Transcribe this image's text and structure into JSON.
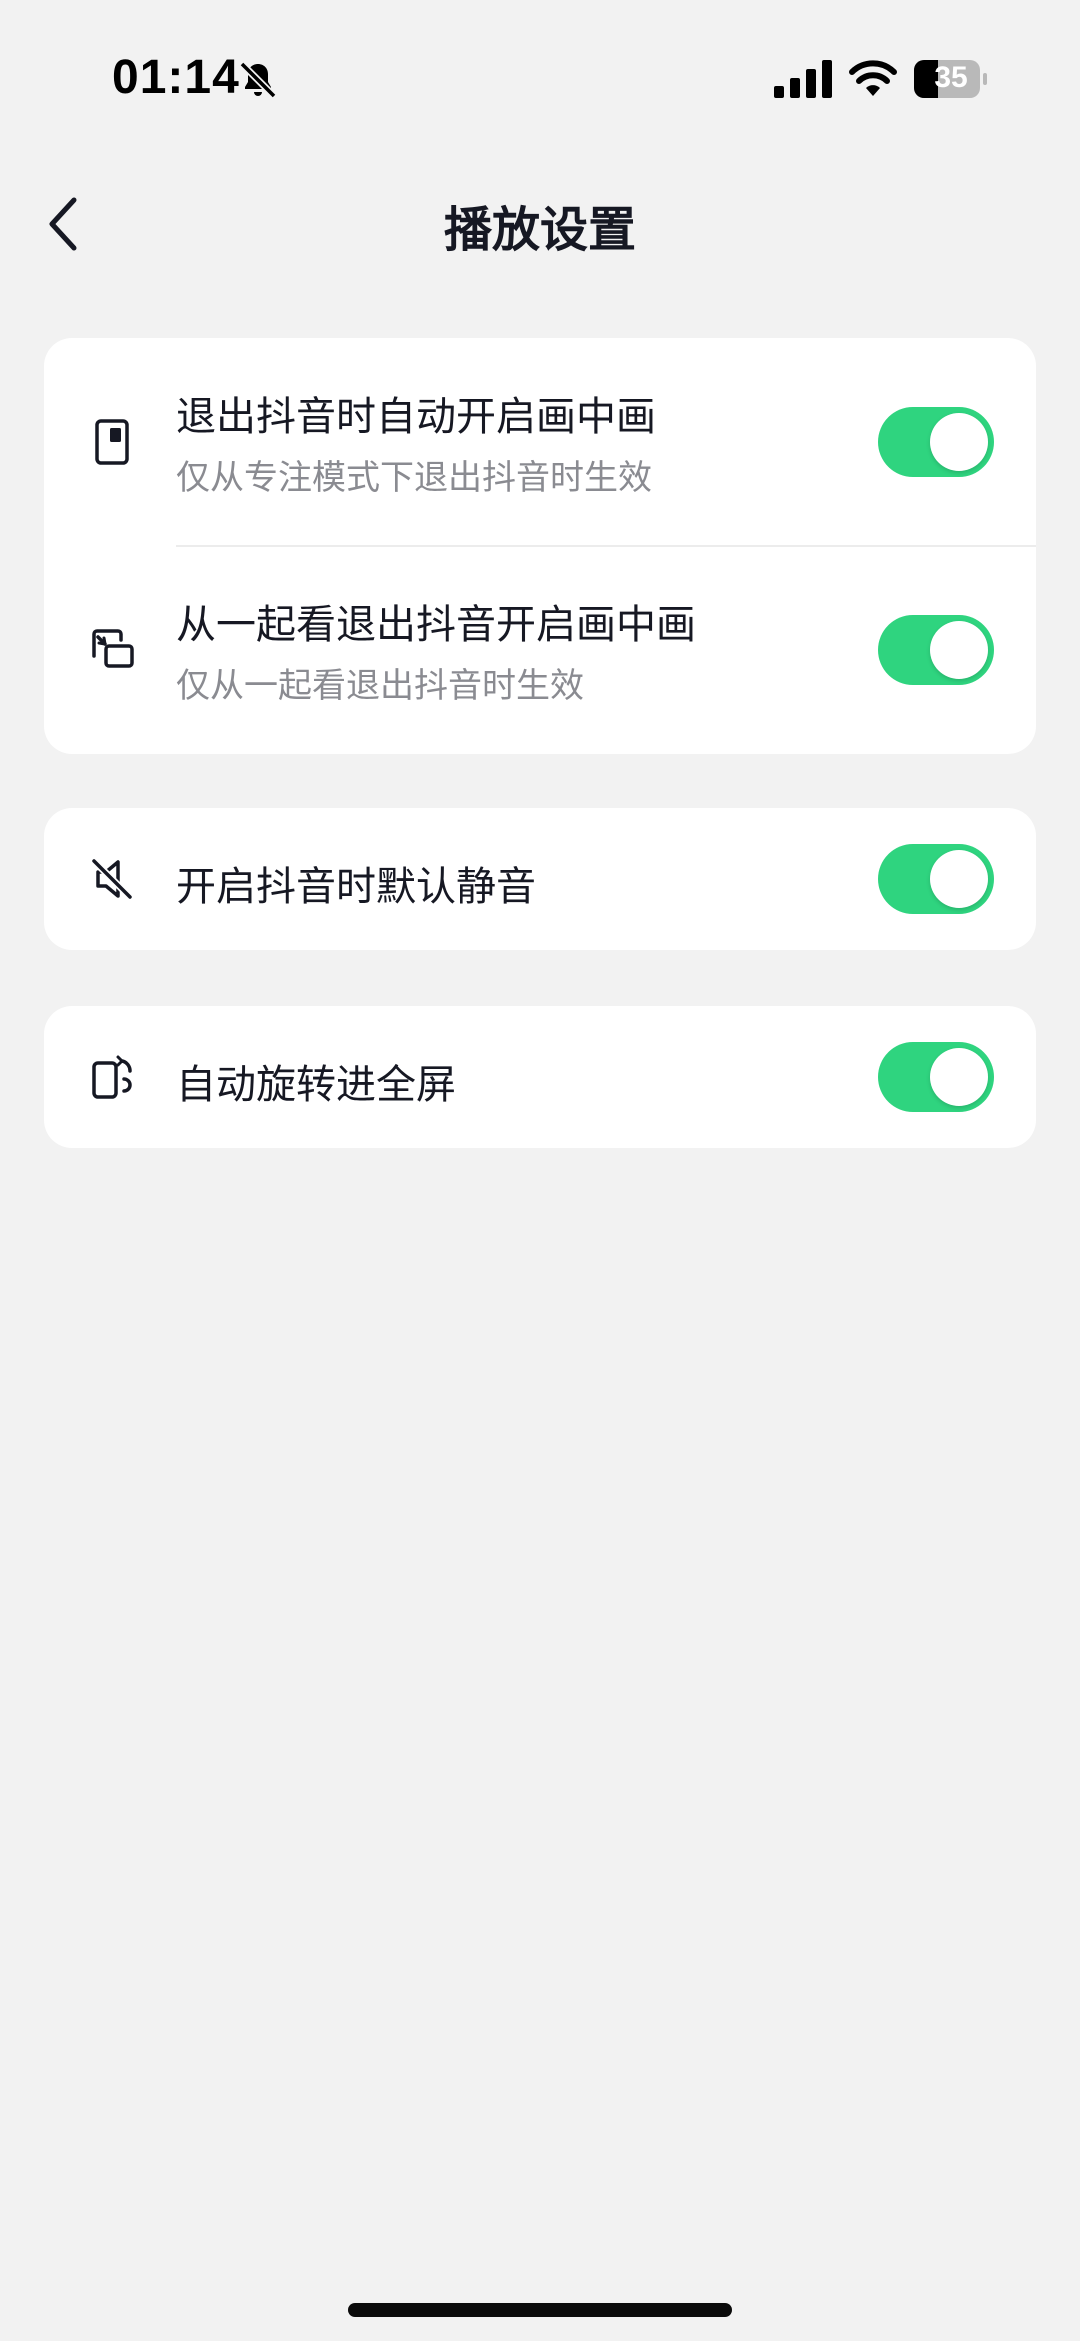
{
  "status_bar": {
    "time": "01:14",
    "battery": "35",
    "icons": [
      "bell-off-icon",
      "signal-icon",
      "wifi-icon",
      "battery-icon"
    ]
  },
  "header": {
    "title": "播放设置",
    "back_icon": "chevron-left-icon"
  },
  "settings": {
    "pip_auto": {
      "title": "退出抖音时自动开启画中画",
      "subtitle": "仅从专注模式下退出抖音时生效",
      "enabled": true,
      "icon": "picture-in-picture-icon"
    },
    "pip_watch_together": {
      "title": "从一起看退出抖音开启画中画",
      "subtitle": "仅从一起看退出抖音时生效",
      "enabled": true,
      "icon": "window-switch-icon"
    },
    "mute_default": {
      "title": "开启抖音时默认静音",
      "enabled": true,
      "icon": "speaker-muted-icon"
    },
    "auto_rotate": {
      "title": "自动旋转进全屏",
      "enabled": true,
      "icon": "rotate-phone-icon"
    }
  },
  "colors": {
    "background": "#f2f2f2",
    "card": "#ffffff",
    "toggle_on": "#2fd47f",
    "primary_text": "#161823",
    "secondary_text": "#8a8b91"
  }
}
